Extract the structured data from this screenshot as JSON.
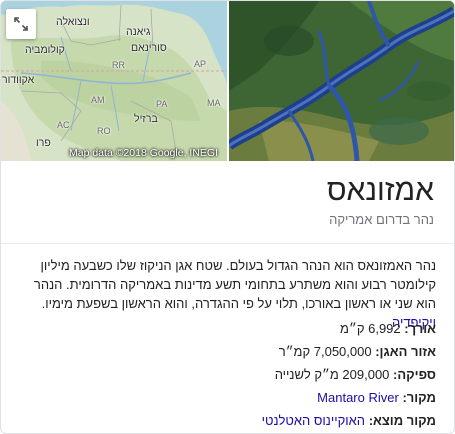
{
  "map": {
    "labels": {
      "venezuela": "ונצואלה",
      "guyana": "גיאנה",
      "suriname": "סורינאם",
      "colombia": "קולומביה",
      "ecuador": "אקוודור",
      "brazil": "ברזיל",
      "peru": "פרו",
      "rr": "RR",
      "ap": "AP",
      "am": "AM",
      "pa": "PA",
      "ma": "MA",
      "ac": "AC",
      "ro": "RO"
    },
    "attribution": "Map data ©2018 Google, INEGI"
  },
  "entity": {
    "title": "אמזונאס",
    "subtitle": "נהר בדרום אמריקה"
  },
  "description": {
    "text": "נהר האמזונאס הוא הנהר הגדול בעולם. שטח אגן הניקוז שלו כשבעה מיליון קילומטר רבוע והוא משתרע בתחומי תשע מדינות באמריקה הדרומית. הנהר הוא שני או ראשון באורכו, תלוי על פי ההגדרה, והוא הראשון בשפעת מימיו.",
    "source_link": "ויקיפדיה"
  },
  "facts": [
    {
      "label": "אורך:",
      "value": "6,992 ק״מ",
      "link": false
    },
    {
      "label": "אזור האגן:",
      "value": "7,050,000 קמ״ר",
      "link": false
    },
    {
      "label": "ספיקה:",
      "value": "209,000 מ״ק לשנייה",
      "link": false
    },
    {
      "label": "מקור:",
      "value": "Mantaro River",
      "link": true
    },
    {
      "label": "מקור מוצא:",
      "value": "האוקיינוס האטלנטי",
      "link": true
    }
  ]
}
